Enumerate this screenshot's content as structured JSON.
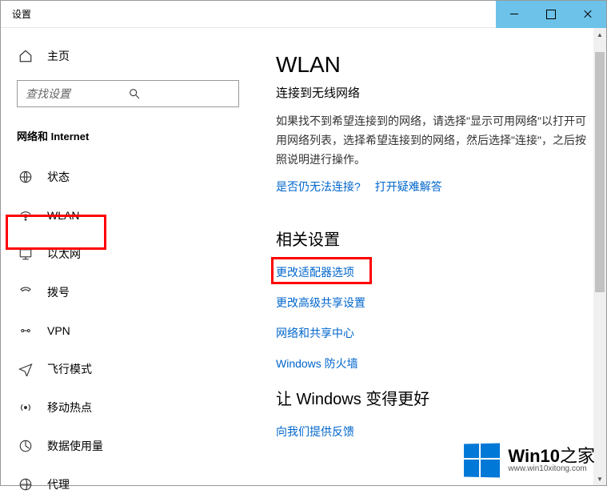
{
  "titlebar": {
    "title": "设置"
  },
  "sidebar": {
    "home": "主页",
    "search_placeholder": "查找设置",
    "section": "网络和 Internet",
    "items": [
      {
        "label": "状态"
      },
      {
        "label": "WLAN"
      },
      {
        "label": "以太网"
      },
      {
        "label": "拨号"
      },
      {
        "label": "VPN"
      },
      {
        "label": "飞行模式"
      },
      {
        "label": "移动热点"
      },
      {
        "label": "数据使用量"
      },
      {
        "label": "代理"
      }
    ]
  },
  "content": {
    "heading": "WLAN",
    "subtitle": "连接到无线网络",
    "body": "如果找不到希望连接到的网络，请选择\"显示可用网络\"以打开可用网络列表，选择希望连接到的网络，然后选择\"连接\"，之后按照说明进行操作。",
    "help_q": "是否仍无法连接?",
    "help_link": "打开疑难解答",
    "related_heading": "相关设置",
    "related_links": [
      "更改适配器选项",
      "更改高级共享设置",
      "网络和共享中心",
      "Windows 防火墙"
    ],
    "feedback_heading": "让 Windows 变得更好",
    "feedback_link": "向我们提供反馈"
  },
  "watermark": {
    "brand": "Win10",
    "suffix": "之家",
    "url": "www.win10xitong.com"
  }
}
